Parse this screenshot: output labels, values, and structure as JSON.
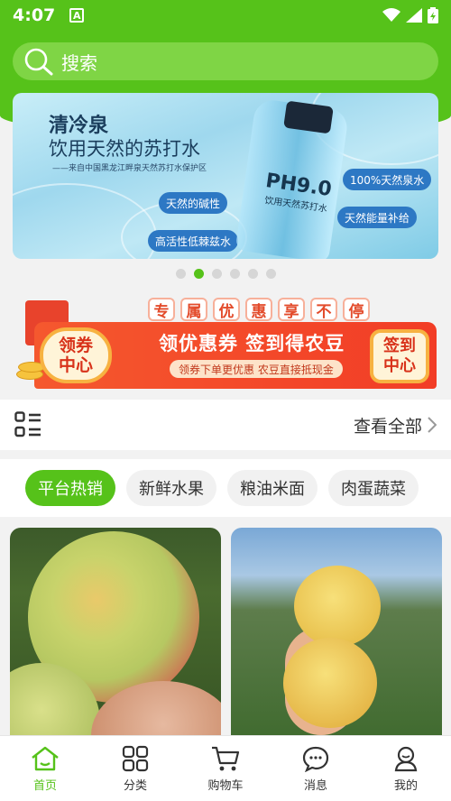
{
  "status": {
    "time": "4:07",
    "a_badge": "A"
  },
  "search": {
    "placeholder": "搜索"
  },
  "banner": {
    "title1": "清冷泉",
    "title2": "饮用天然的苏打水",
    "subtitle": "——来自中国黑龙江畔泉天然苏打水保护区",
    "pill_1": "天然的碱性",
    "pill_2": "高活性低棘兹水",
    "pill_3": "100%天然泉水",
    "pill_4": "天然能量补给",
    "bottle_ph": "PH9.0",
    "bottle_text": "饮用天然苏打水",
    "slide_index": 2,
    "slide_count": 6
  },
  "promo": {
    "tags": [
      "专",
      "属",
      "优",
      "惠",
      "享",
      "不",
      "停"
    ],
    "main": "领优惠券 签到得农豆",
    "sub": "领券下单更优惠  农豆直接抵现金",
    "left_line1": "领券",
    "left_line2": "中心",
    "right_line1": "签到",
    "right_line2": "中心"
  },
  "section": {
    "view_all": "查看全部"
  },
  "tabs": [
    {
      "label": "平台热销",
      "active": true
    },
    {
      "label": "新鲜水果",
      "active": false
    },
    {
      "label": "粮油米面",
      "active": false
    },
    {
      "label": "肉蛋蔬菜",
      "active": false
    }
  ],
  "nav": [
    {
      "label": "首页",
      "icon": "home-icon",
      "active": true
    },
    {
      "label": "分类",
      "icon": "category-icon",
      "active": false
    },
    {
      "label": "购物车",
      "icon": "cart-icon",
      "active": false
    },
    {
      "label": "消息",
      "icon": "message-icon",
      "active": false
    },
    {
      "label": "我的",
      "icon": "profile-icon",
      "active": false
    }
  ],
  "colors": {
    "brand_green": "#56c21a",
    "promo_red": "#f23d26"
  }
}
